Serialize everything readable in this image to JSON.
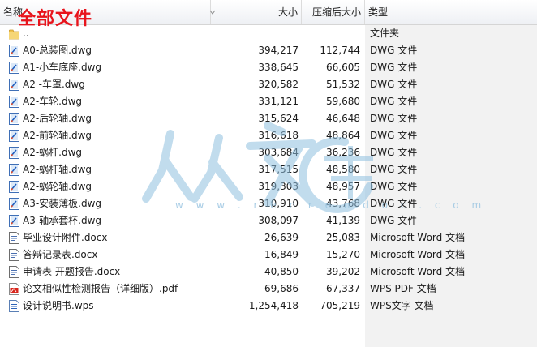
{
  "overlay_title": "全部文件",
  "header": {
    "name": "名称",
    "size": "大小",
    "packed": "压缩后大小",
    "type": "类型"
  },
  "watermark_url": "w w w . r e n r e n d o c . c o m",
  "rows": [
    {
      "name": "..",
      "size": "",
      "packed": "",
      "type": "文件夹",
      "icon": "folder-icon"
    },
    {
      "name": "A0-总装图.dwg",
      "size": "394,217",
      "packed": "112,744",
      "type": "DWG 文件",
      "icon": "dwg-file-icon"
    },
    {
      "name": "A1-小车底座.dwg",
      "size": "338,645",
      "packed": "66,605",
      "type": "DWG 文件",
      "icon": "dwg-file-icon"
    },
    {
      "name": "A2 -车罩.dwg",
      "size": "320,582",
      "packed": "51,532",
      "type": "DWG 文件",
      "icon": "dwg-file-icon"
    },
    {
      "name": "A2-车轮.dwg",
      "size": "331,121",
      "packed": "59,680",
      "type": "DWG 文件",
      "icon": "dwg-file-icon"
    },
    {
      "name": "A2-后轮轴.dwg",
      "size": "315,624",
      "packed": "46,648",
      "type": "DWG 文件",
      "icon": "dwg-file-icon"
    },
    {
      "name": "A2-前轮轴.dwg",
      "size": "316,618",
      "packed": "48,864",
      "type": "DWG 文件",
      "icon": "dwg-file-icon"
    },
    {
      "name": "A2-蜗杆.dwg",
      "size": "303,684",
      "packed": "36,236",
      "type": "DWG 文件",
      "icon": "dwg-file-icon"
    },
    {
      "name": "A2-蜗杆轴.dwg",
      "size": "317,515",
      "packed": "48,580",
      "type": "DWG 文件",
      "icon": "dwg-file-icon"
    },
    {
      "name": "A2-蜗轮轴.dwg",
      "size": "319,303",
      "packed": "48,957",
      "type": "DWG 文件",
      "icon": "dwg-file-icon"
    },
    {
      "name": "A3-安装薄板.dwg",
      "size": "310,910",
      "packed": "43,768",
      "type": "DWG 文件",
      "icon": "dwg-file-icon"
    },
    {
      "name": "A3-轴承套杯.dwg",
      "size": "308,097",
      "packed": "41,139",
      "type": "DWG 文件",
      "icon": "dwg-file-icon"
    },
    {
      "name": "毕业设计附件.docx",
      "size": "26,639",
      "packed": "25,083",
      "type": "Microsoft Word 文档",
      "icon": "docx-file-icon"
    },
    {
      "name": "答辩记录表.docx",
      "size": "16,849",
      "packed": "15,270",
      "type": "Microsoft Word 文档",
      "icon": "docx-file-icon"
    },
    {
      "name": "申请表 开题报告.docx",
      "size": "40,850",
      "packed": "39,202",
      "type": "Microsoft Word 文档",
      "icon": "docx-file-icon"
    },
    {
      "name": "论文相似性检测报告（详细版）.pdf",
      "size": "69,686",
      "packed": "67,337",
      "type": "WPS PDF 文档",
      "icon": "pdf-file-icon"
    },
    {
      "name": "设计说明书.wps",
      "size": "1,254,418",
      "packed": "705,219",
      "type": "WPS文字 文档",
      "icon": "wps-file-icon"
    }
  ]
}
